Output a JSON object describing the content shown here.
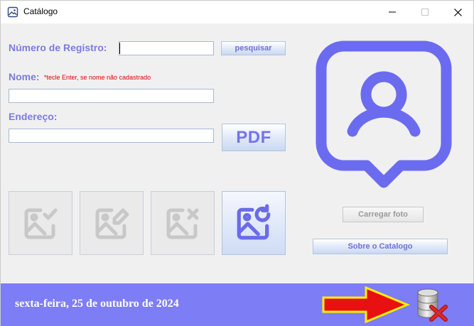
{
  "window": {
    "title": "Catálogo",
    "app_icon": "image-icon",
    "minimize_icon": "minimize-icon",
    "maximize_icon": "maximize-icon",
    "close_icon": "close-icon"
  },
  "form": {
    "registro_label": "Número de Registro:",
    "registro_value": "",
    "search_button": "pesquisar",
    "nome_label": "Nome:",
    "nome_hint": "*tecle Enter, se nome não cadastrado",
    "nome_value": "",
    "endereco_label": "Endereço:",
    "endereco_value": "",
    "pdf_button": "PDF"
  },
  "image_actions": [
    {
      "icon": "image-check-icon",
      "enabled": false
    },
    {
      "icon": "image-edit-icon",
      "enabled": false
    },
    {
      "icon": "image-delete-icon",
      "enabled": false
    },
    {
      "icon": "image-refresh-icon",
      "enabled": true
    }
  ],
  "photo": {
    "placeholder_icon": "user-location-pin-icon",
    "load_button": "Carregar foto",
    "about_button": "Sobre o Catalogo"
  },
  "footer": {
    "date": "sexta-feira, 25 de outubro de 2024",
    "arrow_icon": "red-arrow-icon",
    "db_icon": "database-delete-icon"
  },
  "colors": {
    "accent": "#7d7df6",
    "label": "#7b7be0",
    "hint": "#e00000",
    "arrow_fill": "#e81010",
    "arrow_outline": "#ffee00"
  }
}
